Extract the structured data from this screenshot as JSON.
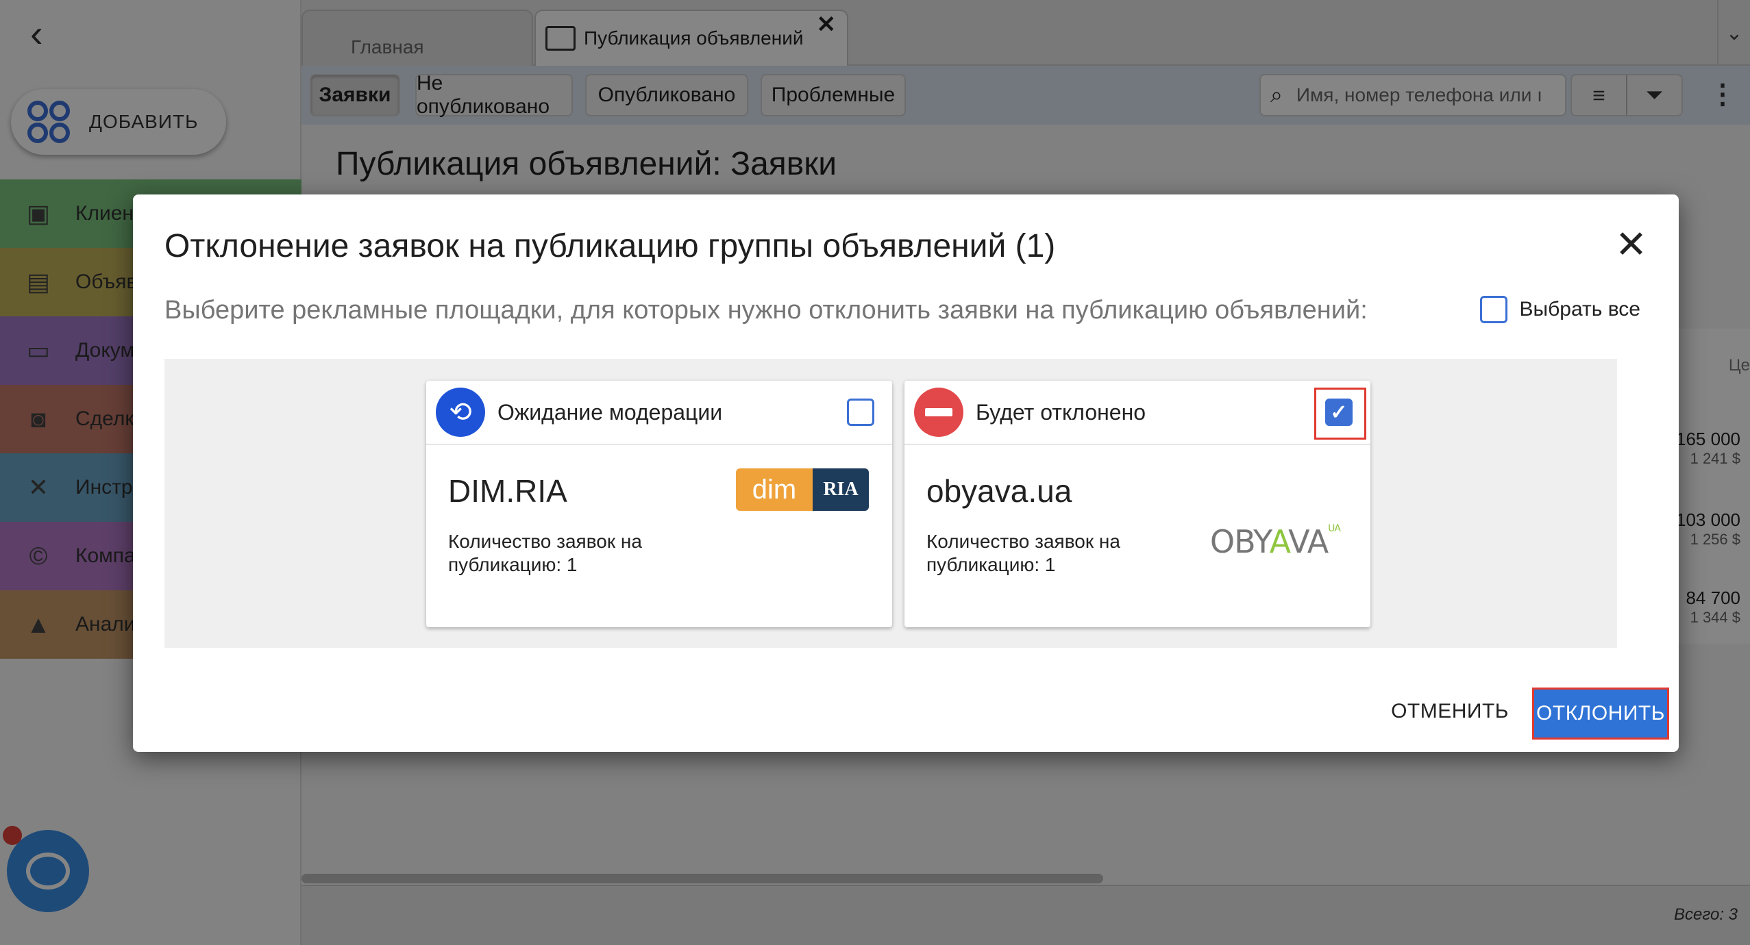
{
  "tabs": {
    "home": "Главная",
    "active": "Публикация объявлений",
    "close_glyph": "✕"
  },
  "sidebar": {
    "add_label": "ДОБАВИТЬ",
    "items": [
      {
        "label": "Клиен",
        "icon": "contacts-icon",
        "color": "#7cc47f"
      },
      {
        "label": "Объяв",
        "icon": "listings-icon",
        "color": "#c4b35a"
      },
      {
        "label": "Докум",
        "icon": "folder-icon",
        "color": "#a07ac8"
      },
      {
        "label": "Сделк",
        "icon": "deals-icon",
        "color": "#c47a6a"
      },
      {
        "label": "Инстр",
        "icon": "tools-icon",
        "color": "#6aa6c8"
      },
      {
        "label": "Компа",
        "icon": "company-icon",
        "color": "#b27ac8"
      },
      {
        "label": "Анали",
        "icon": "analytics-icon",
        "color": "#c89a6a"
      }
    ]
  },
  "toolbar": {
    "filters": [
      "Заявки",
      "Не опубликовано",
      "Опубликовано",
      "Проблемные"
    ],
    "selected_filter": "Заявки",
    "search_placeholder": "Имя, номер телефона или ı"
  },
  "page": {
    "title": "Публикация объявлений: Заявки",
    "column_header": "Це",
    "prices": [
      {
        "main": "165 000",
        "sub": "1 241 $"
      },
      {
        "main": "103 000",
        "sub": "1 256 $"
      },
      {
        "main": "84 700",
        "sub": "1 344 $"
      }
    ],
    "total": "Всего: 3"
  },
  "dialog": {
    "title": "Отклонение заявок на публикацию группы объявлений (1)",
    "subtitle": "Выберите рекламные площадки, для которых нужно отклонить заявки на публикацию объявлений:",
    "select_all": "Выбрать все",
    "select_all_checked": false,
    "cards": [
      {
        "status": "Ожидание модерации",
        "status_icon": "history-clock-icon",
        "checked": false,
        "site": "DIM.RIA",
        "count": "Количество заявок на публикацию: 1",
        "logo_left": "dim",
        "logo_right": "RIA"
      },
      {
        "status": "Будет отклонено",
        "status_icon": "minus-circle-icon",
        "checked": true,
        "site": "obyava.ua",
        "count": "Количество заявок на публикацию: 1",
        "logo_text_a": "OBY",
        "logo_text_v": "A",
        "logo_text_b": "VA",
        "logo_sup": "UA"
      }
    ],
    "cancel": "ОТМЕНИТЬ",
    "reject": "ОТКЛОНИТЬ"
  },
  "colors": {
    "accent": "#2f73d6",
    "wait_status": "#1e53d8",
    "reject_status": "#e2484a",
    "highlight": "#e0392f",
    "dimria_orange": "#f0a23a",
    "dimria_navy": "#1d3b5a",
    "obyava_green": "#8fc63f"
  }
}
